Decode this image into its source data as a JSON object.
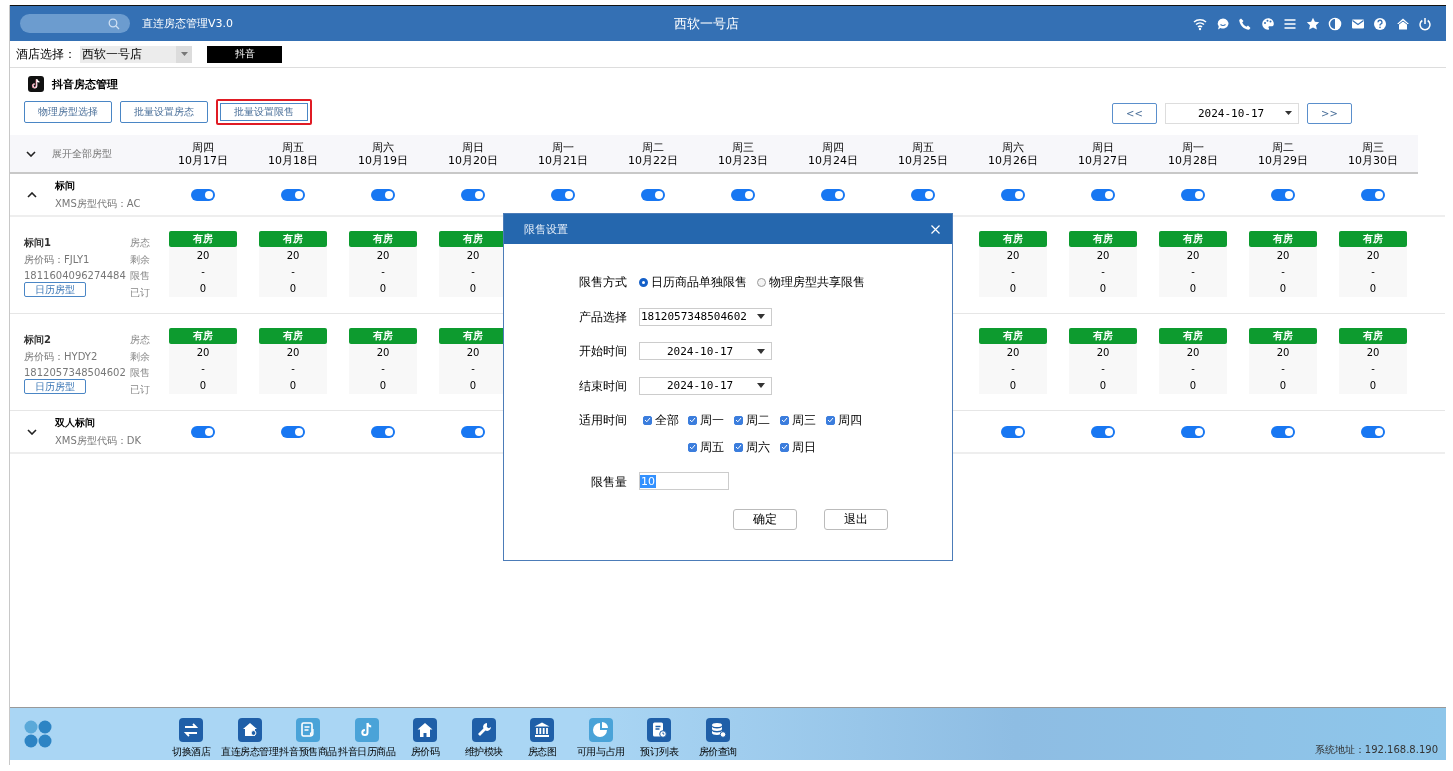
{
  "app": {
    "title": "直连房态管理V3.0",
    "store": "西软一号店"
  },
  "hotel_select": {
    "label": "酒店选择：",
    "value": "西软一号店"
  },
  "channel_tag": "抖音",
  "page_title": "抖音房态管理",
  "actions": [
    {
      "label": "物理房型选择",
      "selected": false
    },
    {
      "label": "批量设置房态",
      "selected": false
    },
    {
      "label": "批量设置限售",
      "selected": true
    }
  ],
  "date_nav": {
    "prev": "<<",
    "date": "2024-10-17",
    "next": ">>"
  },
  "grid": {
    "expand_all": "展开全部房型",
    "days": [
      {
        "weekday": "周四",
        "date": "10月17日"
      },
      {
        "weekday": "周五",
        "date": "10月18日"
      },
      {
        "weekday": "周六",
        "date": "10月19日"
      },
      {
        "weekday": "周日",
        "date": "10月20日"
      },
      {
        "weekday": "周一",
        "date": "10月21日"
      },
      {
        "weekday": "周二",
        "date": "10月22日"
      },
      {
        "weekday": "周三",
        "date": "10月23日"
      },
      {
        "weekday": "周四",
        "date": "10月24日"
      },
      {
        "weekday": "周五",
        "date": "10月25日"
      },
      {
        "weekday": "周六",
        "date": "10月26日"
      },
      {
        "weekday": "周日",
        "date": "10月27日"
      },
      {
        "weekday": "周一",
        "date": "10月28日"
      },
      {
        "weekday": "周二",
        "date": "10月29日"
      },
      {
        "weekday": "周三",
        "date": "10月30日"
      }
    ],
    "groups": [
      {
        "name": "标间",
        "code": "XMS房型代码：AC",
        "expanded": true,
        "toggles": [
          {
            "on": true
          },
          {
            "on": true
          },
          {
            "on": true
          },
          {
            "on": true
          },
          {
            "on": true
          },
          {
            "on": true
          },
          {
            "on": true
          },
          {
            "on": true
          },
          {
            "on": true
          },
          {
            "on": true
          },
          {
            "on": true
          },
          {
            "on": true
          },
          {
            "on": true
          },
          {
            "on": true
          }
        ],
        "rooms": [
          {
            "name": "标间1",
            "rate_code": "房价码：FJLY1",
            "product_id": "1811604096274484",
            "tag": "日历房型",
            "row_labels": [
              "房态",
              "剩余",
              "限售",
              "已订"
            ],
            "cells": [
              {
                "status": "有房",
                "remaining": "20",
                "limit": "-",
                "booked": "0"
              },
              {
                "status": "有房",
                "remaining": "20",
                "limit": "-",
                "booked": "0"
              },
              {
                "status": "有房",
                "remaining": "20",
                "limit": "-",
                "booked": "0"
              },
              {
                "status": "有房",
                "remaining": "20",
                "limit": "-",
                "booked": "0"
              }
            ],
            "cells_end": [
              {
                "status": "有房",
                "remaining": "20",
                "limit": "-",
                "booked": "0"
              },
              {
                "status": "有房",
                "remaining": "20",
                "limit": "-",
                "booked": "0"
              },
              {
                "status": "有房",
                "remaining": "20",
                "limit": "-",
                "booked": "0"
              },
              {
                "status": "有房",
                "remaining": "20",
                "limit": "-",
                "booked": "0"
              },
              {
                "status": "有房",
                "remaining": "20",
                "limit": "-",
                "booked": "0"
              }
            ]
          },
          {
            "name": "标间2",
            "rate_code": "房价码：HYDY2",
            "product_id": "1812057348504602",
            "tag": "日历房型",
            "row_labels": [
              "房态",
              "剩余",
              "限售",
              "已订"
            ],
            "cells": [
              {
                "status": "有房",
                "remaining": "20",
                "limit": "-",
                "booked": "0"
              },
              {
                "status": "有房",
                "remaining": "20",
                "limit": "-",
                "booked": "0"
              },
              {
                "status": "有房",
                "remaining": "20",
                "limit": "-",
                "booked": "0"
              },
              {
                "status": "有房",
                "remaining": "20",
                "limit": "-",
                "booked": "0"
              }
            ],
            "cells_end": [
              {
                "status": "有房",
                "remaining": "20",
                "limit": "-",
                "booked": "0"
              },
              {
                "status": "有房",
                "remaining": "20",
                "limit": "-",
                "booked": "0"
              },
              {
                "status": "有房",
                "remaining": "20",
                "limit": "-",
                "booked": "0"
              },
              {
                "status": "有房",
                "remaining": "20",
                "limit": "-",
                "booked": "0"
              },
              {
                "status": "有房",
                "remaining": "20",
                "limit": "-",
                "booked": "0"
              }
            ]
          }
        ]
      },
      {
        "name": "双人标间",
        "code": "XMS房型代码：DK",
        "expanded": false,
        "toggles": [
          {
            "on": true
          },
          {
            "on": true
          },
          {
            "on": true
          },
          {
            "on": true
          }
        ],
        "toggles_end": [
          {
            "on": true
          },
          {
            "on": true
          },
          {
            "on": true
          },
          {
            "on": true
          },
          {
            "on": true
          }
        ]
      }
    ]
  },
  "dialog": {
    "title": "限售设置",
    "mode": {
      "label": "限售方式",
      "options": [
        {
          "label": "日历商品单独限售",
          "selected": true
        },
        {
          "label": "物理房型共享限售",
          "selected": false
        }
      ]
    },
    "product": {
      "label": "产品选择",
      "value": "1812057348504602"
    },
    "start": {
      "label": "开始时间",
      "value": "2024-10-17"
    },
    "end": {
      "label": "结束时间",
      "value": "2024-10-17"
    },
    "days": {
      "label": "适用时间",
      "options": [
        {
          "label": "全部",
          "checked": true
        },
        {
          "label": "周一",
          "checked": true
        },
        {
          "label": "周二",
          "checked": true
        },
        {
          "label": "周三",
          "checked": true
        },
        {
          "label": "周四",
          "checked": true
        },
        {
          "label": "周五",
          "checked": true
        },
        {
          "label": "周六",
          "checked": true
        },
        {
          "label": "周日",
          "checked": true
        }
      ]
    },
    "limit": {
      "label": "限售量",
      "value": "10"
    },
    "buttons": [
      "确定",
      "退出"
    ]
  },
  "dock": {
    "items": [
      "切换酒店",
      "直连房态管理",
      "抖音预售商品",
      "抖音日历商品",
      "房价码",
      "维护模块",
      "房态图",
      "可用与占用",
      "预订列表",
      "房价查询"
    ],
    "status": "系统地址：192.168.8.190"
  }
}
